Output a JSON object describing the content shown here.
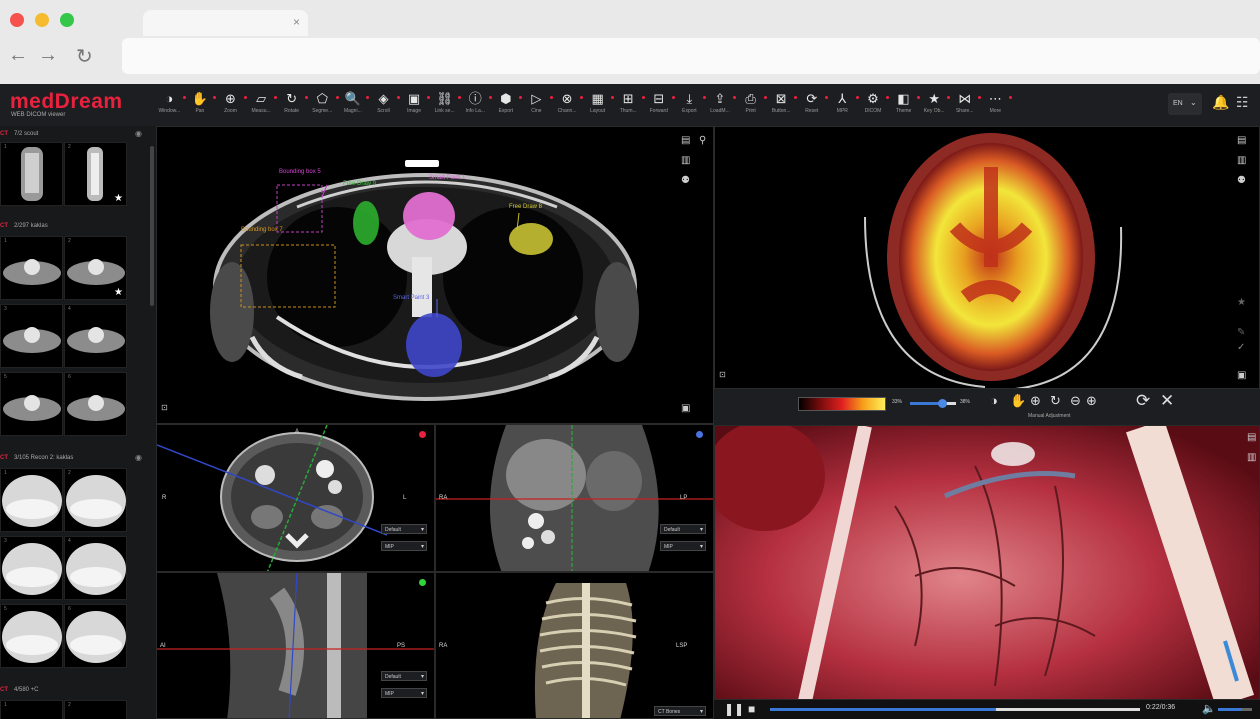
{
  "app": {
    "logo": "medDream",
    "logo_sub": "WEB DICOM viewer",
    "accent": "#e8213e",
    "language": "EN"
  },
  "browser": {
    "tab_close": "×",
    "back": "←",
    "forward": "→",
    "reload": "↻"
  },
  "toolbar": {
    "tools": [
      {
        "icon": "contrast-icon",
        "glyph": "◑",
        "label": "Window..."
      },
      {
        "icon": "pan-icon",
        "glyph": "✋",
        "label": "Pan"
      },
      {
        "icon": "zoom-icon",
        "glyph": "⊕",
        "label": "Zoom"
      },
      {
        "icon": "measure-icon",
        "glyph": "▱",
        "label": "Measu..."
      },
      {
        "icon": "rotate-icon",
        "glyph": "↻",
        "label": "Rotate"
      },
      {
        "icon": "segmentation-icon",
        "glyph": "⬠",
        "label": "Segme..."
      },
      {
        "icon": "magnify-icon",
        "glyph": "🔍",
        "label": "Magni..."
      },
      {
        "icon": "scroll-icon",
        "glyph": "◈",
        "label": "Scroll"
      },
      {
        "icon": "image-icon",
        "glyph": "▣",
        "label": "Image"
      },
      {
        "icon": "link-icon",
        "glyph": "⛓",
        "label": "Link se..."
      },
      {
        "icon": "info-icon",
        "glyph": "ⓘ",
        "label": "Info La..."
      },
      {
        "icon": "export-icon",
        "glyph": "⬢",
        "label": "Export"
      },
      {
        "icon": "cine-icon",
        "glyph": "▷",
        "label": "Cine"
      },
      {
        "icon": "channels-icon",
        "glyph": "⊗",
        "label": "Chann..."
      },
      {
        "icon": "layout-icon",
        "glyph": "▦",
        "label": "Layout"
      },
      {
        "icon": "thumbnails-icon",
        "glyph": "⊞",
        "label": "Thum..."
      },
      {
        "icon": "forward-icon",
        "glyph": "⊟",
        "label": "Forward"
      },
      {
        "icon": "download-icon",
        "glyph": "⤓",
        "label": "Export"
      },
      {
        "icon": "load-icon",
        "glyph": "⇪",
        "label": "LoadM..."
      },
      {
        "icon": "print-icon",
        "glyph": "⎙",
        "label": "Print"
      },
      {
        "icon": "buttons-icon",
        "glyph": "⊠",
        "label": "Button..."
      },
      {
        "icon": "reset-icon",
        "glyph": "⟳",
        "label": "Reset"
      },
      {
        "icon": "mpr-icon",
        "glyph": "⅄",
        "label": "MPR"
      },
      {
        "icon": "dicom-icon",
        "glyph": "⚙",
        "label": "DICOM"
      },
      {
        "icon": "theme-icon",
        "glyph": "◧",
        "label": "Theme"
      },
      {
        "icon": "key-image-icon",
        "glyph": "★",
        "label": "Key Ob..."
      },
      {
        "icon": "share-icon",
        "glyph": "⋈",
        "label": "Share..."
      },
      {
        "icon": "more-icon",
        "glyph": "⋯",
        "label": "More"
      }
    ],
    "bell": "🔔",
    "settings": "☷"
  },
  "sidebar": {
    "series": [
      {
        "modality": "CT",
        "title": "7/2 scout"
      },
      {
        "modality": "CT",
        "title": "2/297 kaklas"
      },
      {
        "modality": "CT",
        "title": "3/105 Recon 2: kaklas"
      },
      {
        "modality": "CT",
        "title": "4/580 +C"
      }
    ],
    "thumb_numbers": [
      "1",
      "2",
      "1",
      "2",
      "3",
      "4",
      "5",
      "6",
      "1",
      "2",
      "3",
      "4",
      "5",
      "6",
      "1",
      "2"
    ],
    "star": "★",
    "eye": "◉"
  },
  "viewports": {
    "ct_annotations": [
      {
        "text": "Bounding box 5",
        "color": "#d247d2"
      },
      {
        "text": "Free Draw 9",
        "color": "#38c238"
      },
      {
        "text": "Smart Paint 1",
        "color": "#e060e0"
      },
      {
        "text": "Free Draw 8",
        "color": "#d8cb3a"
      },
      {
        "text": "Bounding box 7",
        "color": "#d99a1e"
      },
      {
        "text": "Smart Paint 3",
        "color": "#5b64e8"
      }
    ],
    "mpr": {
      "axial": {
        "left": "R",
        "right": "L",
        "top": "A",
        "dot_color": "#e8213e"
      },
      "coronal": {
        "left": "RA",
        "right": "LP",
        "dot_color": "#4a72e0"
      },
      "sagittal": {
        "left": "AI",
        "right": "PS",
        "dot_color": "#2ed63a"
      },
      "volume": {
        "left": "RA",
        "right": "LSP",
        "preset": "CT Bones"
      },
      "presets": [
        "Default",
        "MIP"
      ]
    },
    "pet": {
      "min_pct": "33%",
      "max_pct": "38%",
      "caption": "Manual Adjustment"
    },
    "video": {
      "time": "0:22/0:36",
      "progress": 0.61,
      "volume_level": 0.7
    }
  }
}
